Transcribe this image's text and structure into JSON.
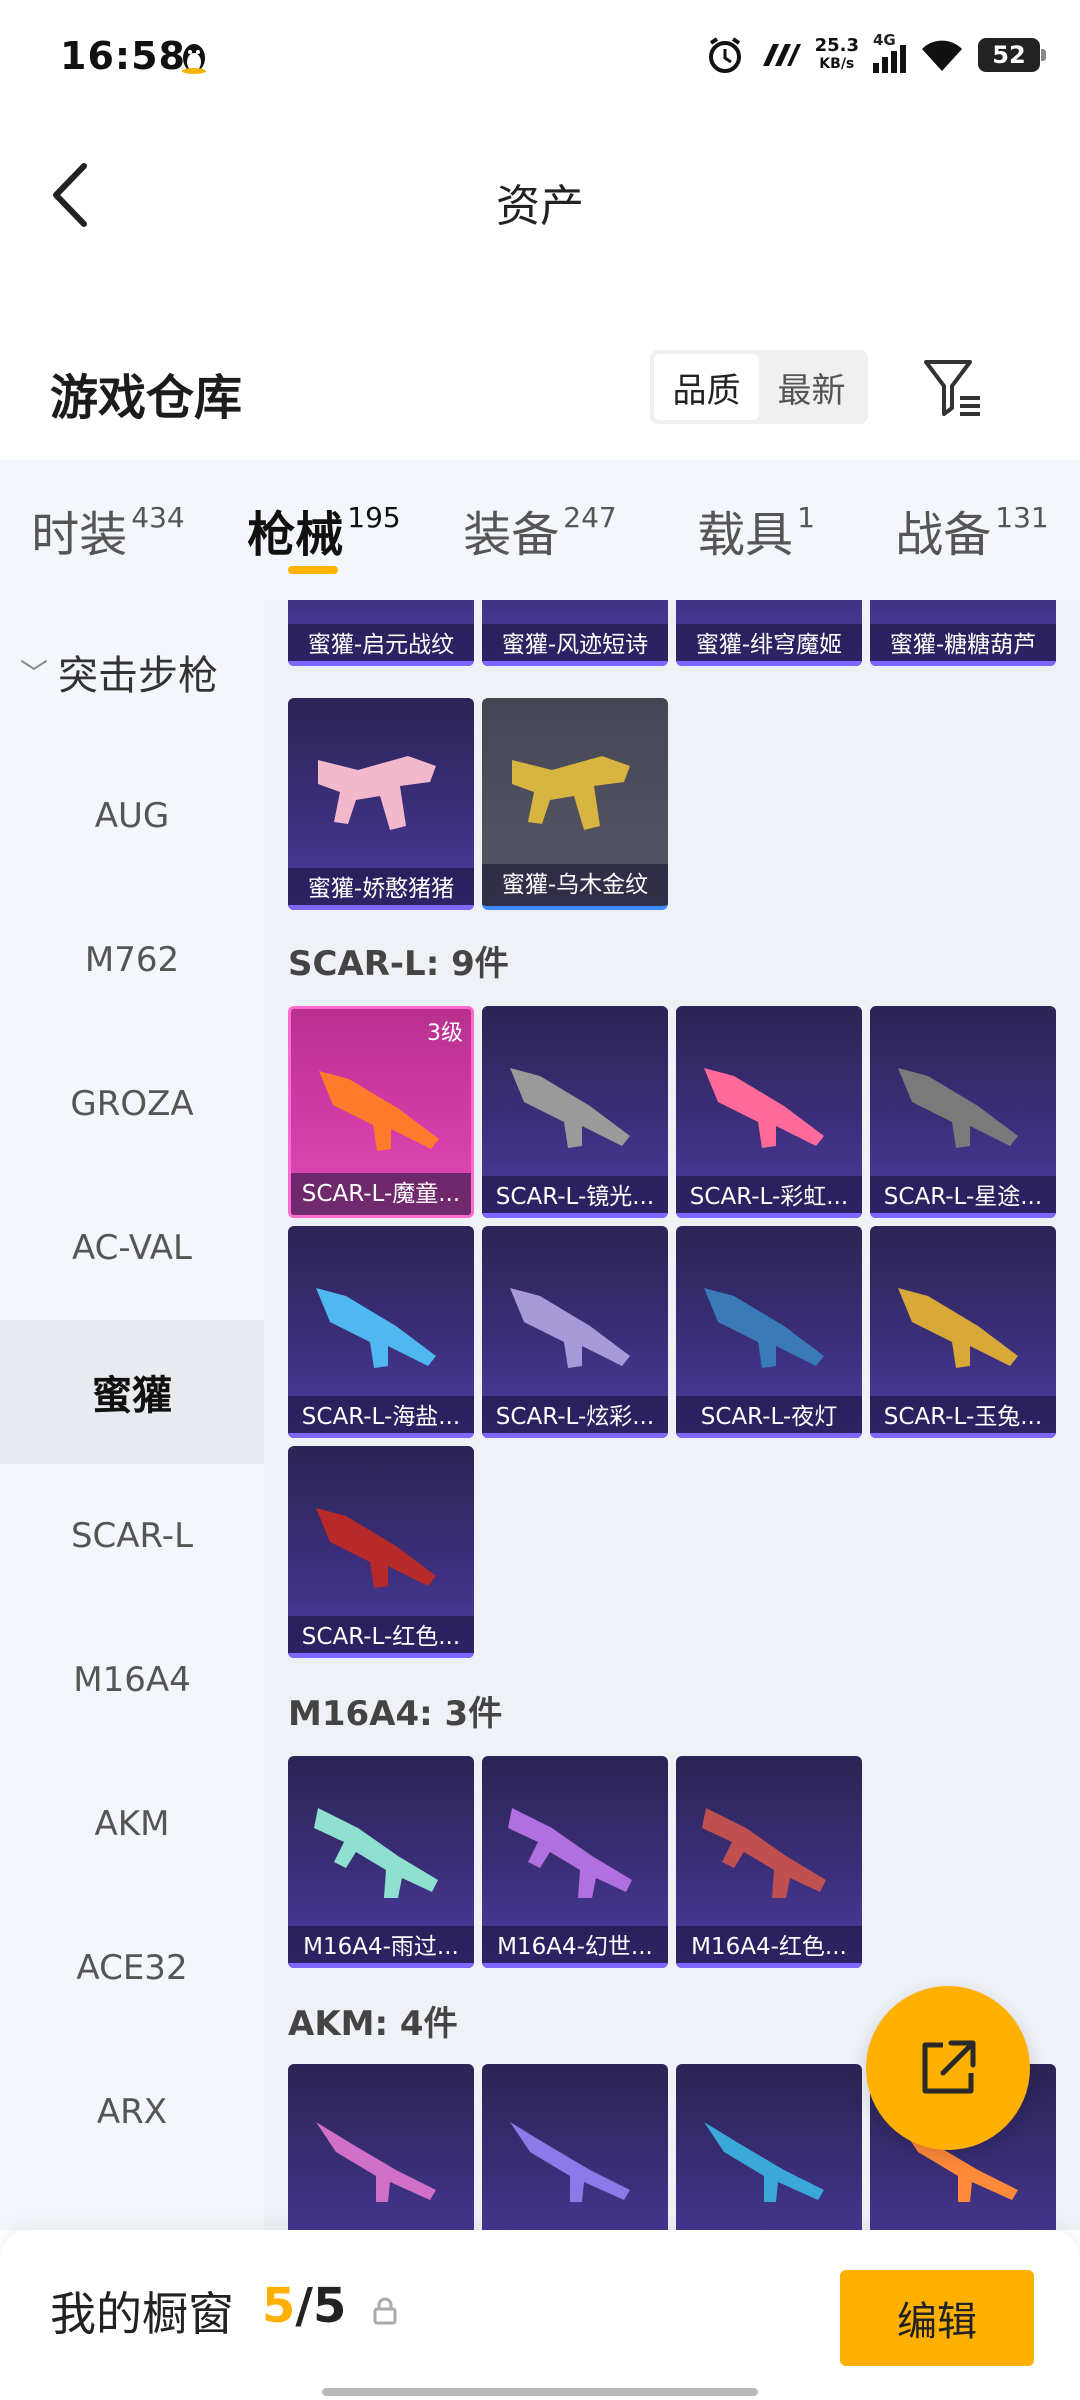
{
  "status": {
    "time": "16:58",
    "net_speed": "25.3",
    "net_unit": "KB/s",
    "signal": "4G",
    "battery": "52"
  },
  "header": {
    "back_icon": "chevron-left-icon",
    "title": "资产"
  },
  "warehouse": {
    "title": "游戏仓库",
    "sort_options": [
      "品质",
      "最新"
    ],
    "active_sort": "品质",
    "filter_icon": "filter-icon"
  },
  "tabs": [
    {
      "label": "时装",
      "count": "434"
    },
    {
      "label": "枪械",
      "count": "195",
      "active": true
    },
    {
      "label": "装备",
      "count": "247"
    },
    {
      "label": "载具",
      "count": "1"
    },
    {
      "label": "战备",
      "count": "131"
    }
  ],
  "sidebar": {
    "category": "突击步枪",
    "items": [
      "AUG",
      "M762",
      "GROZA",
      "AC-VAL",
      "蜜獾",
      "SCAR-L",
      "M16A4",
      "AKM",
      "ACE32",
      "ARX"
    ],
    "active": "蜜獾"
  },
  "sections": {
    "honeybadger_top": [
      "蜜獾-启元战纹",
      "蜜獾-风迹短诗",
      "蜜獾-绯穹魔姬",
      "蜜獾-糖糖葫芦"
    ],
    "honeybadger_more": [
      "蜜獾-娇憨猪猪",
      "蜜獾-乌木金纹"
    ],
    "scar_label": "SCAR-L: 9件",
    "scar": [
      "SCAR-L-魔童...",
      "SCAR-L-镜光...",
      "SCAR-L-彩虹...",
      "SCAR-L-星途...",
      "SCAR-L-海盐...",
      "SCAR-L-炫彩...",
      "SCAR-L-夜灯",
      "SCAR-L-玉兔...",
      "SCAR-L-红色..."
    ],
    "scar_level": "3级",
    "m16_label": "M16A4: 3件",
    "m16": [
      "M16A4-雨过...",
      "M16A4-幻世...",
      "M16A4-红色..."
    ],
    "akm_label": "AKM: 4件"
  },
  "fab": {
    "icon": "share-external-icon"
  },
  "bottom": {
    "label": "我的橱窗",
    "current": "5",
    "total": "/5",
    "edit": "编辑"
  },
  "colors": {
    "accent": "#ffb000",
    "card_purple": "#3b2f7a",
    "card_pink": "#d23ca8"
  }
}
